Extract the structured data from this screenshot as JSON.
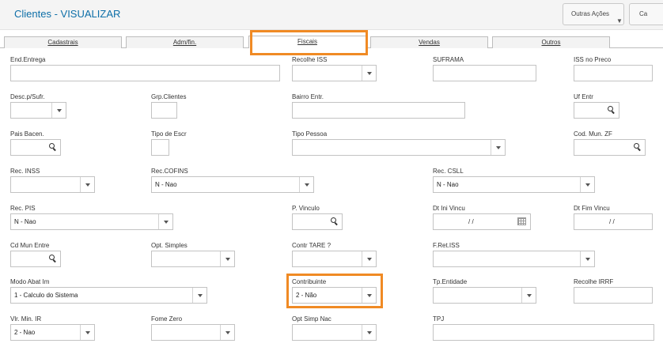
{
  "header": {
    "title": "Clientes - VISUALIZAR",
    "actions_label": "Outras Ações",
    "more_label": "Ca"
  },
  "tabs": [
    {
      "label": "Cadastrais",
      "active": false
    },
    {
      "label": "Adm/fin.",
      "active": false
    },
    {
      "label": "Fiscais",
      "active": true
    },
    {
      "label": "Vendas",
      "active": false
    },
    {
      "label": "Outros",
      "active": false
    }
  ],
  "fields": {
    "end_entrega": {
      "label": "End.Entrega",
      "value": ""
    },
    "recolhe_iss": {
      "label": "Recolhe ISS",
      "value": ""
    },
    "suframa": {
      "label": "SUFRAMA",
      "value": ""
    },
    "iss_no_preco": {
      "label": "ISS no Preco",
      "value": ""
    },
    "desc_sufr": {
      "label": "Desc.p/Sufr.",
      "value": ""
    },
    "grp_clientes": {
      "label": "Grp.Clientes",
      "value": ""
    },
    "bairro_entr": {
      "label": "Bairro Entr.",
      "value": ""
    },
    "uf_entr": {
      "label": "Uf Entr",
      "value": ""
    },
    "pais_bacen": {
      "label": "Pais Bacen.",
      "value": ""
    },
    "tipo_escr": {
      "label": "Tipo de Escr",
      "value": ""
    },
    "tipo_pessoa": {
      "label": "Tipo Pessoa",
      "value": ""
    },
    "cod_mun_zf": {
      "label": "Cod. Mun. ZF",
      "value": ""
    },
    "rec_inss": {
      "label": "Rec. INSS",
      "value": ""
    },
    "rec_cofins": {
      "label": "Rec.COFINS",
      "value": "N - Nao"
    },
    "rec_csll": {
      "label": "Rec. CSLL",
      "value": "N - Nao"
    },
    "rec_pis": {
      "label": "Rec. PIS",
      "value": "N - Nao"
    },
    "p_vinculo": {
      "label": "P. Vinculo",
      "value": ""
    },
    "dt_ini_vincu": {
      "label": "Dt Ini Vincu",
      "value": "/ /"
    },
    "dt_fim_vincu": {
      "label": "Dt Fim Vincu",
      "value": "/ /"
    },
    "cd_mun_entre": {
      "label": "Cd Mun Entre",
      "value": ""
    },
    "opt_simples": {
      "label": "Opt. Simples",
      "value": ""
    },
    "contr_tare": {
      "label": "Contr TARE ?",
      "value": ""
    },
    "f_ret_iss": {
      "label": "F.Ret.ISS",
      "value": ""
    },
    "modo_abat_im": {
      "label": "Modo Abat Im",
      "value": "1 - Calculo do Sistema"
    },
    "contribuinte": {
      "label": "Contribuinte",
      "value": "2 - Não"
    },
    "tp_entidade": {
      "label": "Tp.Entidade",
      "value": ""
    },
    "recolhe_irrf": {
      "label": "Recolhe IRRF",
      "value": ""
    },
    "vlr_min_ir": {
      "label": "Vlr. Min. IR",
      "value": "2 - Nao"
    },
    "fome_zero": {
      "label": "Fome Zero",
      "value": ""
    },
    "opt_simp_nac": {
      "label": "Opt Simp Nac",
      "value": ""
    },
    "tpj": {
      "label": "TPJ",
      "value": ""
    }
  }
}
